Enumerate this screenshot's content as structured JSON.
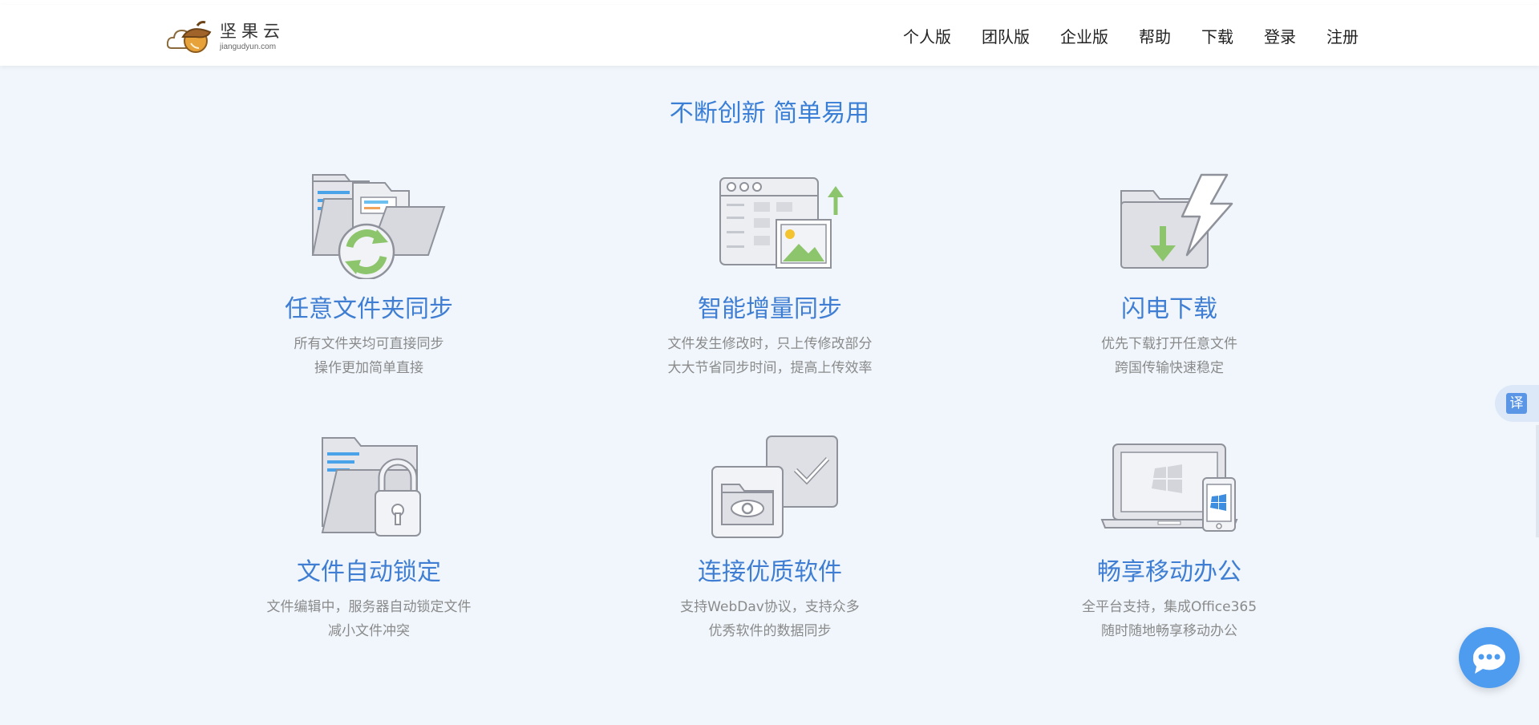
{
  "brand": {
    "name": "坚果云",
    "domain": "jiangudyun.com"
  },
  "nav": {
    "items": [
      "个人版",
      "团队版",
      "企业版",
      "帮助",
      "下载",
      "登录",
      "注册"
    ]
  },
  "section": {
    "title": "不断创新 简单易用"
  },
  "features": [
    {
      "icon": "folder-sync-icon",
      "title": "任意文件夹同步",
      "line1": "所有文件夹均可直接同步",
      "line2": "操作更加简单直接"
    },
    {
      "icon": "incremental-sync-icon",
      "title": "智能增量同步",
      "line1": "文件发生修改时，只上传修改部分",
      "line2": "大大节省同步时间，提高上传效率"
    },
    {
      "icon": "lightning-download-icon",
      "title": "闪电下载",
      "line1": "优先下载打开任意文件",
      "line2": "跨国传输快速稳定"
    },
    {
      "icon": "file-lock-icon",
      "title": "文件自动锁定",
      "line1": "文件编辑中，服务器自动锁定文件",
      "line2": "减小文件冲突"
    },
    {
      "icon": "quality-software-icon",
      "title": "连接优质软件",
      "line1": "支持WebDav协议，支持众多",
      "line2": "优秀软件的数据同步"
    },
    {
      "icon": "mobile-office-icon",
      "title": "畅享移动办公",
      "line1": "全平台支持，集成Office365",
      "line2": "随时随地畅享移动办公"
    }
  ],
  "widgets": {
    "translate_label": "译"
  },
  "colors": {
    "accent": "#3f7ed2",
    "page_bg": "#f0f6fc",
    "green": "#8cc56b",
    "icon_gray": "#e0e1e6"
  }
}
